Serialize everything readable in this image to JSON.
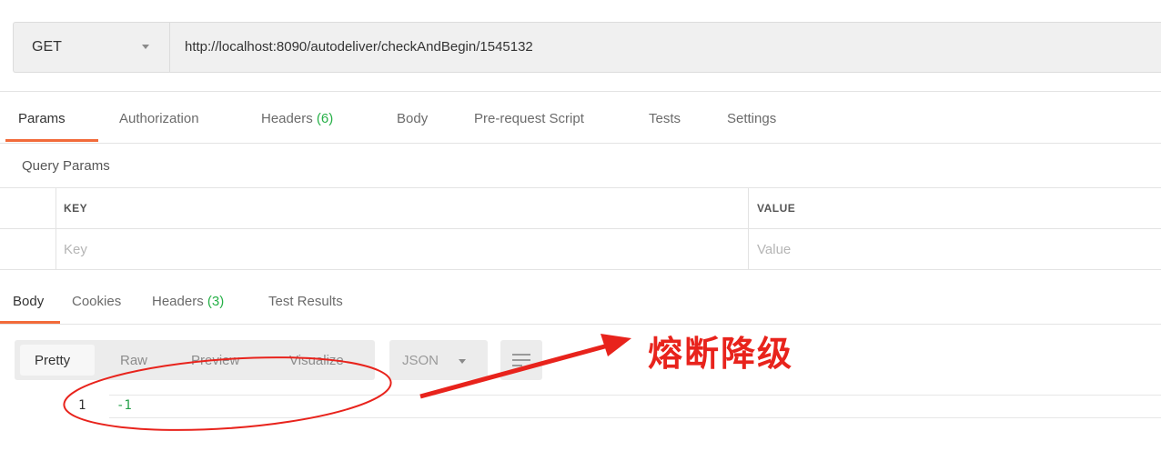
{
  "request": {
    "method": "GET",
    "url": "http://localhost:8090/autodeliver/checkAndBegin/1545132"
  },
  "request_tabs": [
    {
      "label": "Params",
      "badge": ""
    },
    {
      "label": "Authorization",
      "badge": ""
    },
    {
      "label": "Headers",
      "badge": "(6)"
    },
    {
      "label": "Body",
      "badge": ""
    },
    {
      "label": "Pre-request Script",
      "badge": ""
    },
    {
      "label": "Tests",
      "badge": ""
    },
    {
      "label": "Settings",
      "badge": ""
    }
  ],
  "query_params": {
    "title": "Query Params",
    "columns": {
      "key": "KEY",
      "value": "VALUE"
    },
    "placeholders": {
      "key": "Key",
      "value": "Value"
    }
  },
  "response_tabs": [
    {
      "label": "Body",
      "badge": ""
    },
    {
      "label": "Cookies",
      "badge": ""
    },
    {
      "label": "Headers",
      "badge": "(3)"
    },
    {
      "label": "Test Results",
      "badge": ""
    }
  ],
  "response_toolbar": {
    "views": [
      "Pretty",
      "Raw",
      "Preview",
      "Visualize"
    ],
    "format": "JSON"
  },
  "response_body": {
    "line_number": "1",
    "value": "-1"
  },
  "annotation": {
    "text": "熔断降级",
    "color": "#e8231c"
  },
  "colors": {
    "active_tab_underline": "#f26b3a",
    "badge_green": "#26b047",
    "code_green": "#26a04a"
  }
}
